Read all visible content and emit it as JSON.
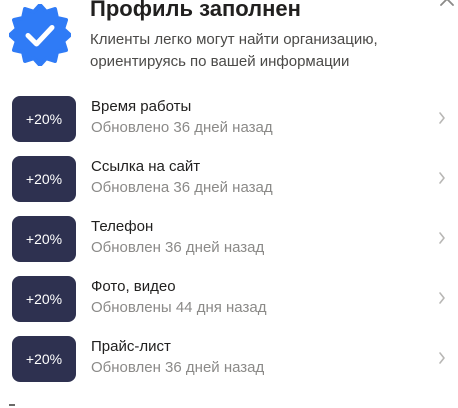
{
  "header": {
    "title": "Профиль заполнен",
    "subtitle": "Клиенты легко могут найти организацию, ориентируясь по вашей информации",
    "icon": "verified-badge-icon",
    "collapse_icon": "chevron-up-icon"
  },
  "items": [
    {
      "badge": "+20%",
      "title": "Время работы",
      "status": "Обновлено 36 дней назад"
    },
    {
      "badge": "+20%",
      "title": "Ссылка на сайт",
      "status": "Обновлена 36 дней назад"
    },
    {
      "badge": "+20%",
      "title": "Телефон",
      "status": "Обновлен 36 дней назад"
    },
    {
      "badge": "+20%",
      "title": "Фото, видео",
      "status": "Обновлены 44 дня назад"
    },
    {
      "badge": "+20%",
      "title": "Прайс-лист",
      "status": "Обновлен 36 дней назад"
    }
  ],
  "colors": {
    "badge_blue": "#2f7bf6",
    "pill_bg": "#2e3150",
    "title_text": "#21201f",
    "secondary_text": "#8b8a88",
    "chevron": "#b8b7b5"
  }
}
